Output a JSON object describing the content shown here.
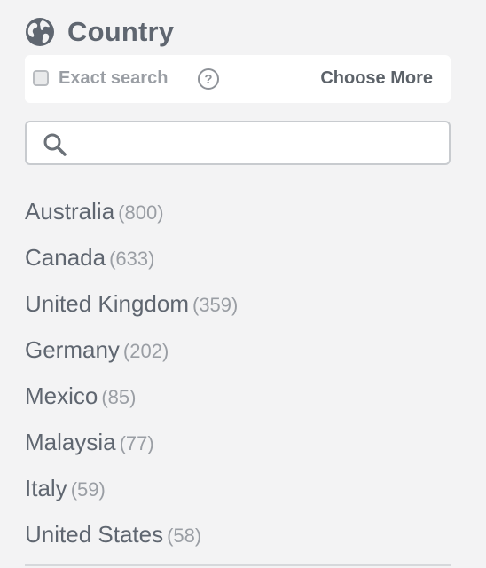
{
  "header": {
    "title": "Country",
    "icon": "globe-icon"
  },
  "options": {
    "exact_search_label": "Exact search",
    "exact_search_checked": false,
    "help_icon": "question-circle-icon",
    "help_glyph": "?",
    "choose_more_label": "Choose More"
  },
  "search": {
    "value": "",
    "placeholder": "",
    "icon": "search-icon"
  },
  "countries": [
    {
      "name": "Australia",
      "count": "(800)"
    },
    {
      "name": "Canada",
      "count": "(633)"
    },
    {
      "name": "United Kingdom",
      "count": "(359)"
    },
    {
      "name": "Germany",
      "count": "(202)"
    },
    {
      "name": "Mexico",
      "count": "(85)"
    },
    {
      "name": "Malaysia",
      "count": "(77)"
    },
    {
      "name": "Italy",
      "count": "(59)"
    },
    {
      "name": "United States",
      "count": "(58)"
    }
  ],
  "colors": {
    "text_primary": "#5f6670",
    "text_muted": "#9a9ea4",
    "background": "#f3f3f4"
  }
}
